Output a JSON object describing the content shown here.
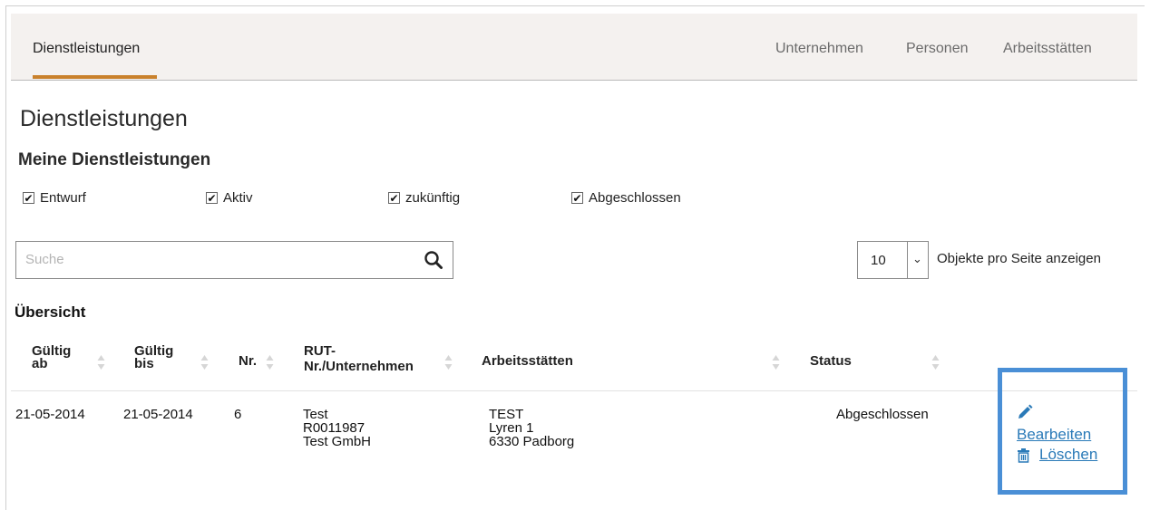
{
  "nav": {
    "active_tab": "Dienstleistungen",
    "tabs": [
      "Unternehmen",
      "Personen",
      "Arbeitsstätten"
    ]
  },
  "page": {
    "title": "Dienstleistungen",
    "subtitle": "Meine Dienstleistungen"
  },
  "filters": [
    {
      "label": "Entwurf",
      "checked": true
    },
    {
      "label": "Aktiv",
      "checked": true
    },
    {
      "label": "zukünftig",
      "checked": true
    },
    {
      "label": "Abgeschlossen",
      "checked": true
    }
  ],
  "search": {
    "placeholder": "Suche",
    "value": ""
  },
  "page_size": {
    "value": "10",
    "label": "Objekte pro Seite anzeigen"
  },
  "overview_title": "Übersicht",
  "table": {
    "headers": {
      "gueltig_ab": [
        "Gültig",
        "ab"
      ],
      "gueltig_bis": [
        "Gültig",
        "bis"
      ],
      "nr": "Nr.",
      "rut": [
        "RUT-",
        "Nr./Unternehmen"
      ],
      "arbeitsstaetten": "Arbeitsstätten",
      "status": "Status"
    },
    "rows": [
      {
        "gueltig_ab": "21-05-2014",
        "gueltig_bis": "21-05-2014",
        "nr": "6",
        "rut": [
          "Test",
          "R0011987",
          "Test GmbH"
        ],
        "arbeitsstaetten": [
          "TEST",
          "Lyren 1",
          "6330 Padborg"
        ],
        "status": "Abgeschlossen",
        "actions": {
          "edit": "Bearbeiten",
          "delete": "Löschen"
        }
      }
    ]
  },
  "colors": {
    "accent_tab": "#c9812c",
    "link": "#2a7ab8",
    "highlight": "#4a8fd6",
    "nav_bg": "#f4f1ef"
  },
  "icons": [
    "search-icon",
    "chevron-down-icon",
    "sort-icon",
    "pencil-icon",
    "trash-icon",
    "checkmark-icon"
  ]
}
